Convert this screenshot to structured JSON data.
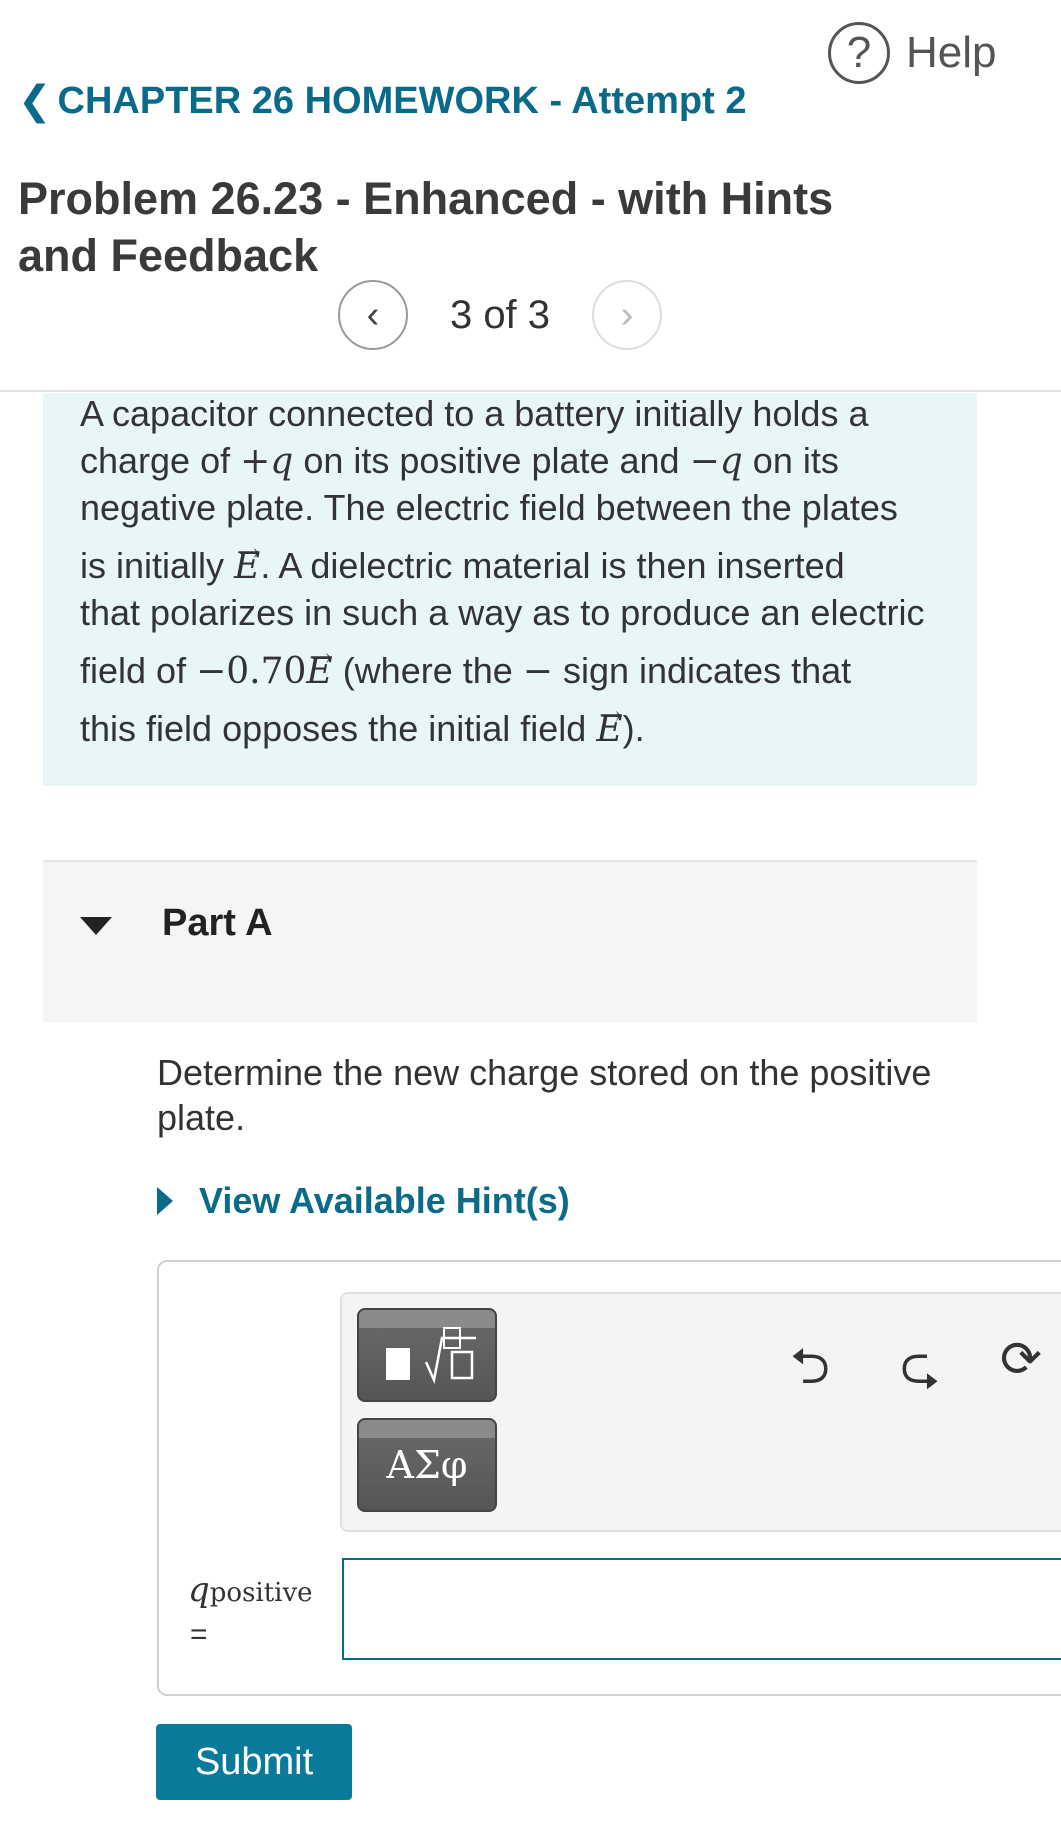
{
  "header": {
    "help_label": "Help",
    "back_label": "CHAPTER 26 HOMEWORK - Attempt 2"
  },
  "problem": {
    "title": "Problem 26.23 - Enhanced - with Hints and Feedback",
    "pager": "3 of 3",
    "text": {
      "l1": "A capacitor connected to a battery initially holds a",
      "l2a": "charge of ",
      "l2b": " on its positive plate and ",
      "l2c": " on its",
      "l3": "negative plate. The electric field between the plates",
      "l4a": "is initially ",
      "l4b": ". A dielectric material is then inserted",
      "l5": "that polarizes in such a way as to produce an electric",
      "l6a": "field of ",
      "l6b": " (where the ",
      "l6c": " sign indicates that",
      "l7a": "this field opposes the initial field ",
      "l7b": ").",
      "plus_q": "+q",
      "minus_q": "−q",
      "E": "E",
      "neg_coef": "−0.70",
      "minus_sign": "−"
    }
  },
  "part": {
    "label": "Part A",
    "question": "Determine the new charge stored on the positive plate.",
    "hint_label": "View Available Hint(s)",
    "variable": "q",
    "variable_sub": "positive",
    "equals": "=",
    "input_value": "",
    "greek_label": "ΑΣφ",
    "submit_label": "Submit"
  },
  "icons": [
    "help-icon",
    "chevron-left-icon",
    "chevron-right-icon",
    "caret-down-icon",
    "caret-right-icon",
    "undo-icon",
    "redo-icon",
    "reset-icon",
    "template-icon"
  ],
  "colors": {
    "accent": "#0a6a8a",
    "problem_bg": "#e8f6f7",
    "submit_bg": "#0a7a9a"
  }
}
